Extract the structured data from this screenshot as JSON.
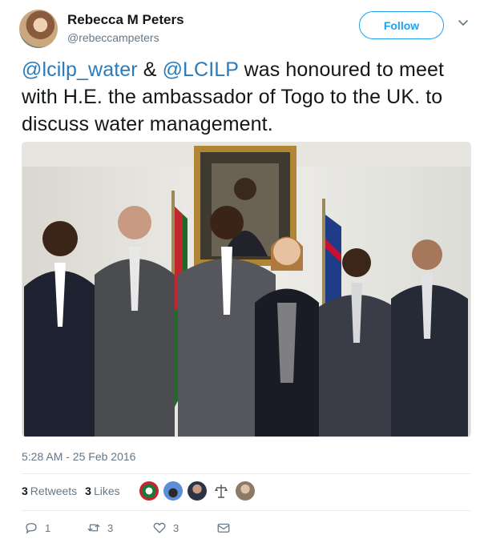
{
  "author": {
    "name": "Rebecca M Peters",
    "handle": "@rebeccampeters"
  },
  "follow_label": "Follow",
  "tweet": {
    "mention_1": "@lcilp_water",
    "connector": " & ",
    "mention_2": "@LCILP",
    "body": " was honoured to meet with H.E. the ambassador of Togo to the UK. to discuss water management."
  },
  "timestamp": "5:28 AM - 25 Feb 2016",
  "stats": {
    "retweets_count": "3",
    "retweets_label": "Retweets",
    "likes_count": "3",
    "likes_label": "Likes"
  },
  "actions": {
    "replies": "1",
    "retweets": "3",
    "likes": "3"
  },
  "colors": {
    "accent": "#1da1f2",
    "link": "#2b7bb9",
    "muted": "#657786"
  },
  "icons": {
    "caret": "chevron-down-icon",
    "reply": "reply-icon",
    "retweet": "retweet-icon",
    "like": "heart-icon",
    "dm": "envelope-icon"
  }
}
